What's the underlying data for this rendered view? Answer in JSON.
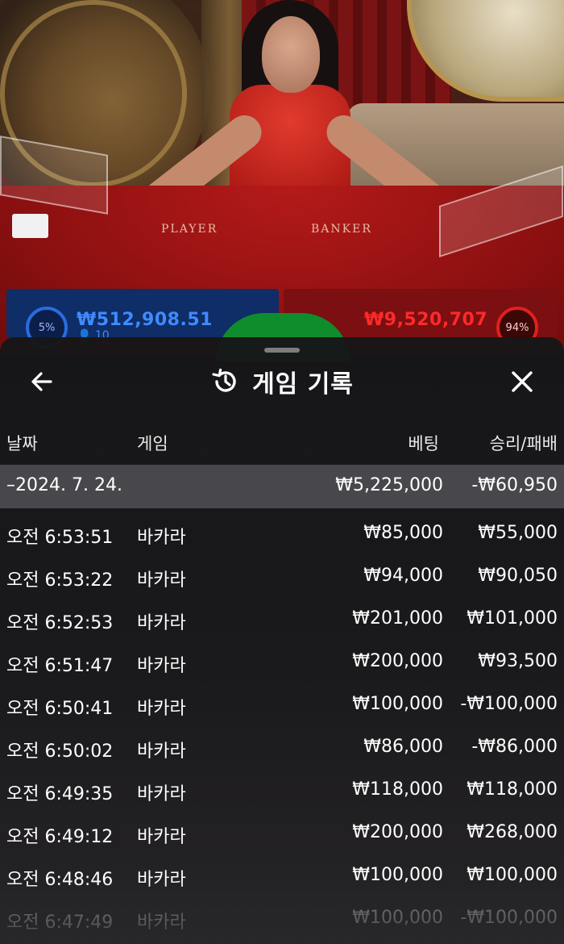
{
  "table": {
    "player_label": "PLAYER",
    "banker_label": "BANKER"
  },
  "stats": {
    "player_pct": "5%",
    "player_amount": "₩512,908.51",
    "player_count": "👤 10",
    "banker_amount": "₩9,520,707",
    "banker_pct": "94%"
  },
  "history": {
    "title": "게임 기록",
    "back_icon": "arrow-left-icon",
    "title_icon": "history-clock-icon",
    "close_icon": "close-icon",
    "columns": {
      "date": "날짜",
      "game": "게임",
      "bet": "베팅",
      "winloss": "승리/패배"
    },
    "summary": {
      "date": "–2024. 7. 24.",
      "bet": "₩5,225,000",
      "winloss": "-₩60,950"
    },
    "rows": [
      {
        "time": "오전 6:53:51",
        "game": "바카라",
        "bet": "₩85,000",
        "winloss": "₩55,000"
      },
      {
        "time": "오전 6:53:22",
        "game": "바카라",
        "bet": "₩94,000",
        "winloss": "₩90,050"
      },
      {
        "time": "오전 6:52:53",
        "game": "바카라",
        "bet": "₩201,000",
        "winloss": "₩101,000"
      },
      {
        "time": "오전 6:51:47",
        "game": "바카라",
        "bet": "₩200,000",
        "winloss": "₩93,500"
      },
      {
        "time": "오전 6:50:41",
        "game": "바카라",
        "bet": "₩100,000",
        "winloss": "-₩100,000"
      },
      {
        "time": "오전 6:50:02",
        "game": "바카라",
        "bet": "₩86,000",
        "winloss": "-₩86,000"
      },
      {
        "time": "오전 6:49:35",
        "game": "바카라",
        "bet": "₩118,000",
        "winloss": "₩118,000"
      },
      {
        "time": "오전 6:49:12",
        "game": "바카라",
        "bet": "₩200,000",
        "winloss": "₩268,000"
      },
      {
        "time": "오전 6:48:46",
        "game": "바카라",
        "bet": "₩100,000",
        "winloss": "₩100,000"
      },
      {
        "time": "오전 6:47:49",
        "game": "바카라",
        "bet": "₩100,000",
        "winloss": "-₩100,000"
      }
    ]
  },
  "colors": {
    "sheet_bg": "#1c1c1e",
    "summary_bg": "#48484c",
    "player_blue": "#3f8bff",
    "banker_red": "#ff2a2a"
  }
}
